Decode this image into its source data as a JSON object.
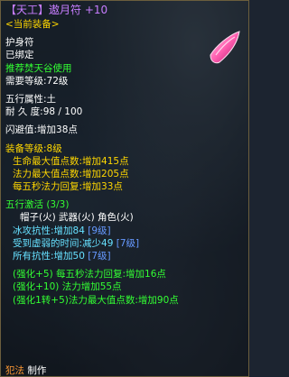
{
  "header": {
    "title_prefix": "【天工】",
    "item_name": "遨月符",
    "refine": "+10",
    "equipped": "<当前装备>"
  },
  "basic": {
    "type": "护身符",
    "bound": "已绑定",
    "recommend": "推荐焚天谷使用",
    "level_req": "需要等级:72级"
  },
  "attributes": {
    "element": "五行属性:土",
    "durability": "耐 久 度:98 / 100",
    "dodge": "闪避值:增加38点"
  },
  "equip_stats": {
    "header": "装备等级:8级",
    "lines": [
      "生命最大值点数:增加415点",
      "法力最大值点数:增加205点",
      "每五秒法力回复:增加33点"
    ]
  },
  "wuxing": {
    "header": "五行激活 (3/3)",
    "parts": "帽子(火)  武器(火)  角色(火)",
    "effects": [
      {
        "text": "冰攻抗性:增加84",
        "badge": "[9级]"
      },
      {
        "text": "受到虚弱的时间:减少49",
        "badge": "[7级]"
      },
      {
        "text": "所有抗性:增加50",
        "badge": "[7级]"
      }
    ]
  },
  "enhance": {
    "lines": [
      "(强化+5)  每五秒法力回复:增加16点",
      "(强化+10) 法力增加55点",
      "(强化1转+5)法力最大值点数:增加90点"
    ]
  },
  "footer": {
    "crafter": "犯法",
    "craft_label": "制作"
  },
  "colors": {
    "item_name": "#c77dff",
    "gold": "#ffd700",
    "green": "#33ff33",
    "cyan": "#66e0ff",
    "orange": "#ff9933",
    "badge": "#6699ff"
  },
  "icons": {
    "item_gem": "pink-gem-icon"
  }
}
